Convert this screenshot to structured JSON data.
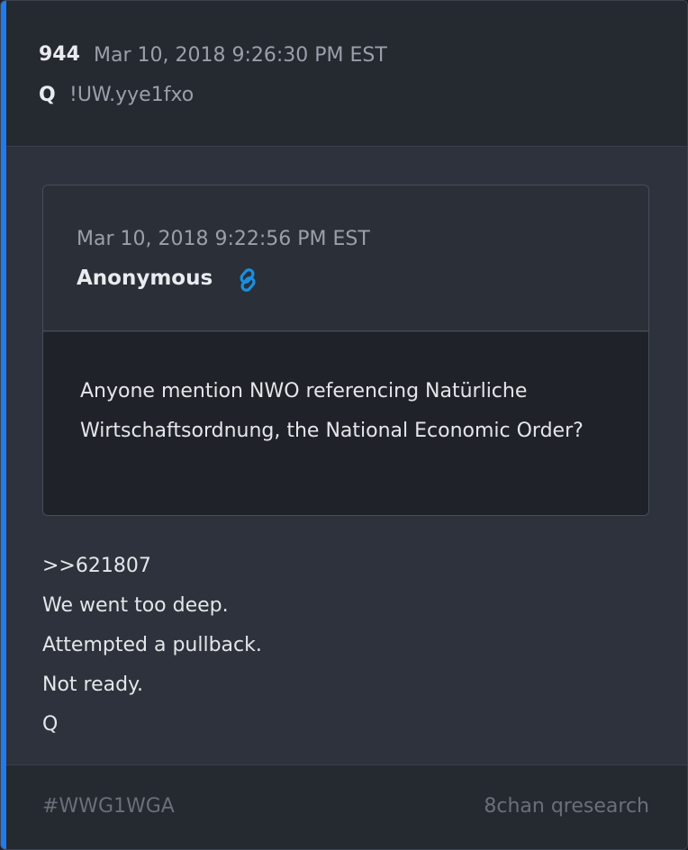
{
  "post": {
    "number": "944",
    "timestamp": "Mar 10, 2018 9:26:30 PM EST",
    "author": "Q",
    "tripcode": "!UW.yye1fxo",
    "accent_color": "#1f7bf0"
  },
  "quoted_post": {
    "timestamp": "Mar 10, 2018 9:22:56 PM EST",
    "author": "Anonymous",
    "link_icon": "link-icon",
    "link_color": "#1a8fe0",
    "text": "Anyone mention NWO referencing Natürliche Wirtschaftsordnung, the National Economic Order?"
  },
  "reply": {
    "lines": [
      ">>621807",
      "We went too deep.",
      "Attempted a pullback.",
      "Not ready.",
      "Q"
    ]
  },
  "footer": {
    "hashtag": "#WWG1WGA",
    "source": "8chan qresearch"
  }
}
